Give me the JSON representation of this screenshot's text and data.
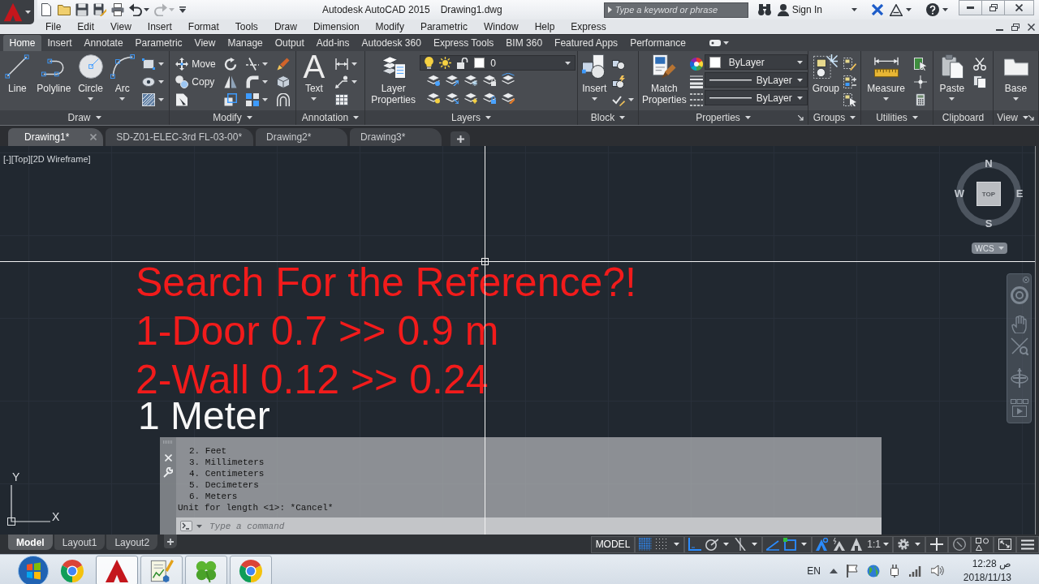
{
  "title_bar": {
    "app_title": "Autodesk AutoCAD 2015",
    "document_title": "Drawing1.dwg",
    "quick_access": [
      {
        "disabled": false
      },
      {
        "disabled": false
      },
      {
        "disabled": false
      },
      {
        "disabled": false
      },
      {
        "disabled": false
      },
      {
        "disabled": false
      },
      {
        "disabled": true
      }
    ],
    "search": {
      "placeholder": "Type a keyword or phrase"
    },
    "sign_in": "Sign In"
  },
  "menu_bar": [
    "File",
    "Edit",
    "View",
    "Insert",
    "Format",
    "Tools",
    "Draw",
    "Dimension",
    "Modify",
    "Parametric",
    "Window",
    "Help",
    "Express"
  ],
  "ribbon_tabs": [
    {
      "label": "Home",
      "selected": true
    },
    {
      "label": "Insert",
      "selected": false
    },
    {
      "label": "Annotate",
      "selected": false
    },
    {
      "label": "Parametric",
      "selected": false
    },
    {
      "label": "View",
      "selected": false
    },
    {
      "label": "Manage",
      "selected": false
    },
    {
      "label": "Output",
      "selected": false
    },
    {
      "label": "Add-ins",
      "selected": false
    },
    {
      "label": "Autodesk 360",
      "selected": false
    },
    {
      "label": "Express Tools",
      "selected": false
    },
    {
      "label": "BIM 360",
      "selected": false
    },
    {
      "label": "Featured Apps",
      "selected": false
    },
    {
      "label": "Performance",
      "selected": false
    }
  ],
  "ribbon_panels": [
    {
      "title": "Draw",
      "expandable": true,
      "launcher": false,
      "columns": [
        {
          "kind": "large",
          "label": "Line",
          "dropdown": false
        },
        {
          "kind": "large",
          "label": "Polyline",
          "dropdown": false
        },
        {
          "kind": "large",
          "label": "Circle",
          "dropdown": true
        },
        {
          "kind": "large",
          "label": "Arc",
          "dropdown": true
        },
        {
          "kind": "stack",
          "items": [
            {
              "dropdown": true
            },
            {
              "dropdown": true
            },
            {
              "dropdown": true
            }
          ]
        }
      ]
    },
    {
      "title": "Modify",
      "expandable": true,
      "launcher": false,
      "columns": [
        {
          "kind": "stack",
          "items": [
            {
              "label": "Move",
              "dropdown": false
            },
            {
              "label": "Copy",
              "dropdown": false
            },
            {
              "dropdown": false
            }
          ]
        },
        {
          "kind": "stack",
          "items": [
            {
              "dropdown": false
            },
            {
              "dropdown": false
            },
            {
              "dropdown": false
            }
          ]
        },
        {
          "kind": "stack",
          "items": [
            {
              "dropdown": true
            },
            {
              "dropdown": true
            },
            {
              "dropdown": true
            }
          ]
        },
        {
          "kind": "stack",
          "items": [
            {
              "dropdown": false
            },
            {
              "dropdown": false
            },
            {
              "dropdown": false
            }
          ]
        }
      ]
    },
    {
      "title": "Annotation",
      "expandable": true,
      "launcher": false,
      "columns": [
        {
          "kind": "large",
          "glyph": "A",
          "label": "Text",
          "dropdown": true
        },
        {
          "kind": "stack",
          "items": [
            {
              "dropdown": true
            },
            {
              "dropdown": true
            },
            {
              "dropdown": false
            }
          ]
        }
      ]
    },
    {
      "title": "Layers",
      "expandable": true,
      "launcher": false,
      "columns": [
        {
          "kind": "large",
          "label": "Layer Properties",
          "dropdown": false
        },
        {
          "kind": "layer_control",
          "value": "0"
        }
      ]
    },
    {
      "title": "Block",
      "expandable": true,
      "launcher": false,
      "columns": [
        {
          "kind": "large",
          "label": "Insert",
          "dropdown": true
        },
        {
          "kind": "stack",
          "items": [
            {
              "dropdown": false
            },
            {
              "dropdown": false
            },
            {
              "dropdown": true
            }
          ]
        }
      ]
    },
    {
      "title": "Properties",
      "expandable": true,
      "launcher": true,
      "columns": [
        {
          "kind": "large",
          "label": "Match Properties",
          "dropdown": false
        },
        {
          "kind": "stack",
          "items": [
            {
              "dropdown": false
            },
            {
              "dropdown": false
            },
            {
              "dropdown": false
            }
          ]
        },
        {
          "kind": "selects",
          "items": [
            "ByLayer",
            "ByLayer",
            "ByLayer"
          ]
        }
      ]
    },
    {
      "title": "Groups",
      "expandable": true,
      "launcher": false,
      "columns": [
        {
          "kind": "large",
          "label": "Group",
          "dropdown": false
        },
        {
          "kind": "stack",
          "items": [
            {
              "dropdown": false
            },
            {
              "dropdown": false
            },
            {
              "dropdown": false
            }
          ]
        }
      ]
    },
    {
      "title": "Utilities",
      "expandable": true,
      "launcher": false,
      "columns": [
        {
          "kind": "large",
          "label": "Measure",
          "dropdown": true
        },
        {
          "kind": "stack",
          "items": [
            {
              "dropdown": false
            },
            {
              "dropdown": false
            },
            {
              "dropdown": false
            }
          ]
        }
      ]
    },
    {
      "title": "Clipboard",
      "expandable": false,
      "launcher": false,
      "columns": [
        {
          "kind": "large",
          "label": "Paste",
          "dropdown": true
        },
        {
          "kind": "stack",
          "items": [
            {
              "dropdown": false
            },
            {
              "dropdown": false
            }
          ]
        }
      ]
    },
    {
      "title": "View",
      "expandable": true,
      "launcher": true,
      "columns": [
        {
          "kind": "large",
          "label": "Base",
          "dropdown": true
        }
      ]
    }
  ],
  "file_tabs": [
    {
      "label": "Drawing1*",
      "selected": true
    },
    {
      "label": "SD-Z01-ELEC-3rd FL-03-00*",
      "selected": false
    },
    {
      "label": "Drawing2*",
      "selected": false
    },
    {
      "label": "Drawing3*",
      "selected": false
    }
  ],
  "viewport": {
    "view_label": "[-][Top][2D Wireframe]",
    "annotations": [
      "Search For the Reference?!",
      "1-Door 0.7 >> 0.9 m",
      "2-Wall 0.12 >> 0.24"
    ],
    "overlay_text": "1 Meter",
    "view_cube": {
      "north": "N",
      "east": "E",
      "south": "S",
      "west": "W",
      "face": "TOP",
      "ucs_menu": "WCS"
    },
    "ucs_axes": {
      "x": "X",
      "y": "Y"
    }
  },
  "command_line": {
    "history": [
      {
        "kind": "option",
        "text": "2. Feet"
      },
      {
        "kind": "option",
        "text": "3. Millimeters"
      },
      {
        "kind": "option",
        "text": "4. Centimeters"
      },
      {
        "kind": "option",
        "text": "5. Decimeters"
      },
      {
        "kind": "option",
        "text": "6. Meters"
      },
      {
        "kind": "prompt",
        "text": "Unit for length <1>: *Cancel*"
      }
    ],
    "placeholder": "Type a command"
  },
  "layout_tabs": [
    {
      "label": "Model",
      "selected": true
    },
    {
      "label": "Layout1",
      "selected": false
    },
    {
      "label": "Layout2",
      "selected": false
    }
  ],
  "status_bar": {
    "space": "MODEL",
    "toggles": [
      {
        "on": true
      },
      {
        "on": false
      },
      {
        "on": true
      },
      {
        "on": false
      },
      {
        "on": false
      },
      {
        "on": true
      },
      {
        "on": true
      },
      {
        "on": true
      },
      {
        "on": false
      },
      {
        "on": false
      }
    ],
    "annotation_scale": "1:1"
  },
  "taskbar": {
    "apps": [
      {
        "running": false,
        "selected": false
      },
      {
        "running": true,
        "selected": true
      },
      {
        "running": true,
        "selected": false
      },
      {
        "running": true,
        "selected": false
      },
      {
        "running": true,
        "selected": false
      }
    ],
    "language": "EN",
    "time": "12:28 ص",
    "date": "2018/11/13"
  }
}
